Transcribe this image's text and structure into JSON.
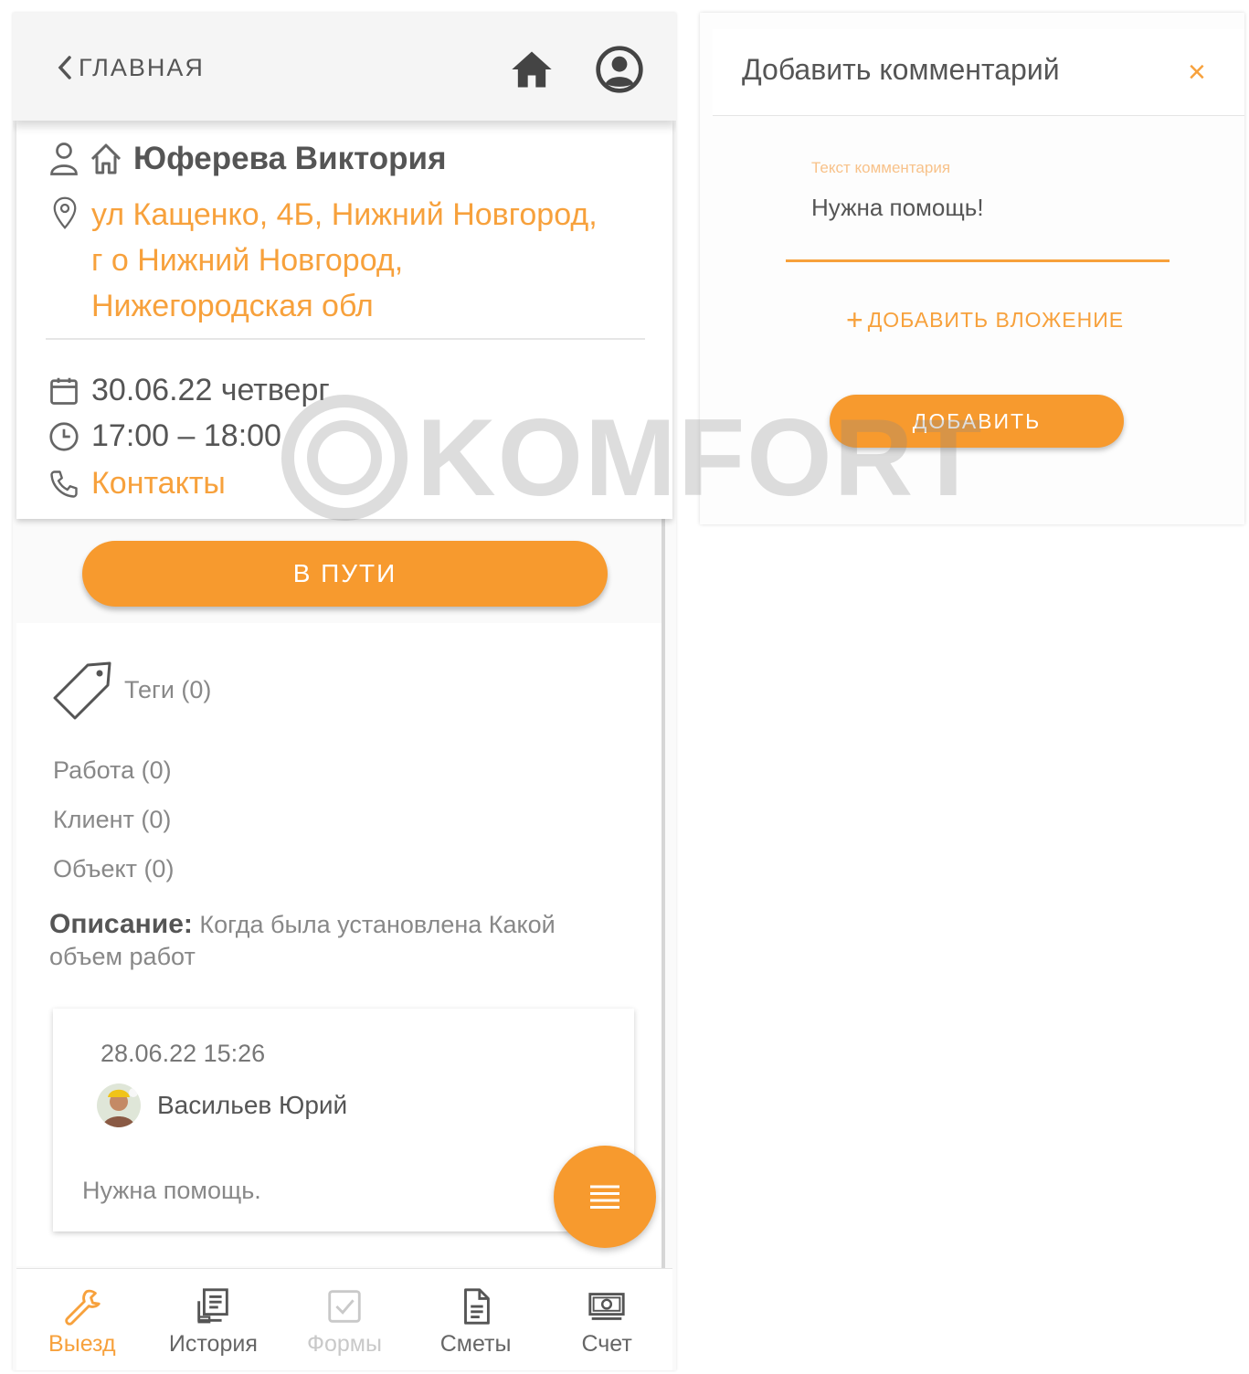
{
  "header": {
    "back_label": "ГЛАВНАЯ"
  },
  "client": {
    "name": "Юферева Виктория",
    "address_lines": [
      "ул Кащенко, 4Б, Нижний Новгород,",
      "г о Нижний Новгород,",
      "Нижегородская обл"
    ],
    "date": "30.06.22 четверг",
    "time": "17:00 – 18:00",
    "contacts_label": "Контакты"
  },
  "status_button": "В ПУТИ",
  "tags": {
    "label": "Теги (0)"
  },
  "categories": [
    "Работа (0)",
    "Клиент (0)",
    "Объект (0)"
  ],
  "description": {
    "label": "Описание:",
    "text": "Когда была установлена Какой объем работ"
  },
  "comment": {
    "date": "28.06.22 15:26",
    "author": "Васильев Юрий",
    "text": "Нужна помощь."
  },
  "bottom_nav": [
    {
      "label": "Выезд",
      "icon": "wrench-icon",
      "state": "active"
    },
    {
      "label": "История",
      "icon": "history-icon",
      "state": "normal"
    },
    {
      "label": "Формы",
      "icon": "checkbox-icon",
      "state": "disabled"
    },
    {
      "label": "Сметы",
      "icon": "document-icon",
      "state": "normal"
    },
    {
      "label": "Счет",
      "icon": "money-icon",
      "state": "normal"
    }
  ],
  "dialog": {
    "title": "Добавить комментарий",
    "close_symbol": "×",
    "field_label": "Текст комментария",
    "field_value": "Нужна помощь!",
    "attach_label": "ДОБАВИТЬ ВЛОЖЕНИЕ",
    "submit_label": "ДОБАВИТЬ"
  },
  "watermark": "KOMFORT",
  "colors": {
    "accent": "#f79a2e",
    "accent_text": "#f7a13c",
    "text": "#555555",
    "muted": "#888888"
  }
}
